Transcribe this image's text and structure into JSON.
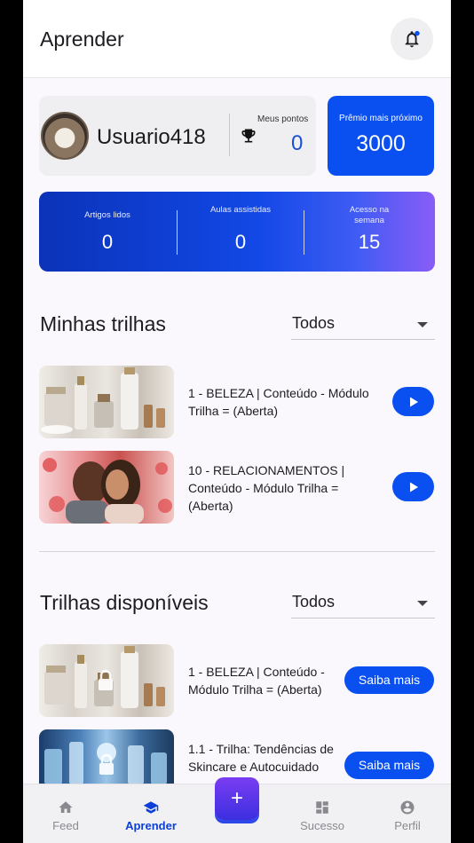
{
  "header": {
    "title": "Aprender",
    "notification_icon": "bell-icon"
  },
  "user": {
    "name": "Usuario418",
    "points_label": "Meus pontos",
    "points": "0"
  },
  "prize": {
    "label": "Prêmio mais próximo",
    "value": "3000"
  },
  "stats": [
    {
      "label": "Artigos lidos",
      "value": "0"
    },
    {
      "label": "Aulas assistidas",
      "value": "0"
    },
    {
      "label": "Acesso na semana",
      "value": "15"
    }
  ],
  "my_trails": {
    "title": "Minhas trilhas",
    "filter": "Todos",
    "items": [
      {
        "text": "1 - BELEZA | Conteúdo - Módulo Trilha = (Aberta)"
      },
      {
        "text": "10 - RELACIONAMENTOS | Conteúdo - Módulo Trilha = (Aberta)"
      }
    ]
  },
  "available_trails": {
    "title": "Trilhas disponíveis",
    "filter": "Todos",
    "button_label": "Saiba mais",
    "items": [
      {
        "text": "1 - BELEZA | Conteúdo - Módulo Trilha = (Aberta)"
      },
      {
        "text": "1.1 - Trilha: Tendências de Skincare e Autocuidado"
      }
    ]
  },
  "bottom_nav": {
    "items": [
      {
        "label": "Feed",
        "icon": "home-icon"
      },
      {
        "label": "Aprender",
        "icon": "graduation-cap-icon",
        "active": true
      },
      {
        "label": "+",
        "icon": "plus-icon"
      },
      {
        "label": "Sucesso",
        "icon": "dashboard-icon"
      },
      {
        "label": "Perfil",
        "icon": "account-circle-icon"
      }
    ]
  },
  "colors": {
    "primary": "#0a4ff0",
    "nav_active": "#0b3fd6"
  }
}
